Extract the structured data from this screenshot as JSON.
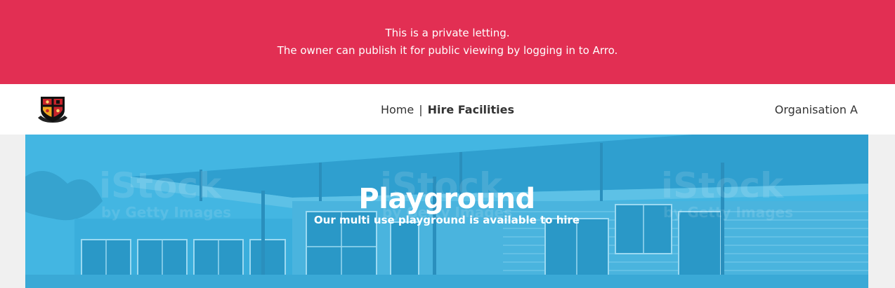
{
  "banner": {
    "line1": "This is a private letting.",
    "line2": "The owner can publish it for public viewing by logging in to Arro.",
    "color": "#e22f53"
  },
  "nav": {
    "logo_icon": "school-crest-icon",
    "links": [
      {
        "label": "Home"
      },
      {
        "label": "Hire Facilities"
      }
    ],
    "separator": "|",
    "organisation": "Organisation A"
  },
  "hero": {
    "title": "Playground",
    "subtitle": "Our multi use playground is available to hire",
    "overlay_color": "#3fb3e0"
  }
}
